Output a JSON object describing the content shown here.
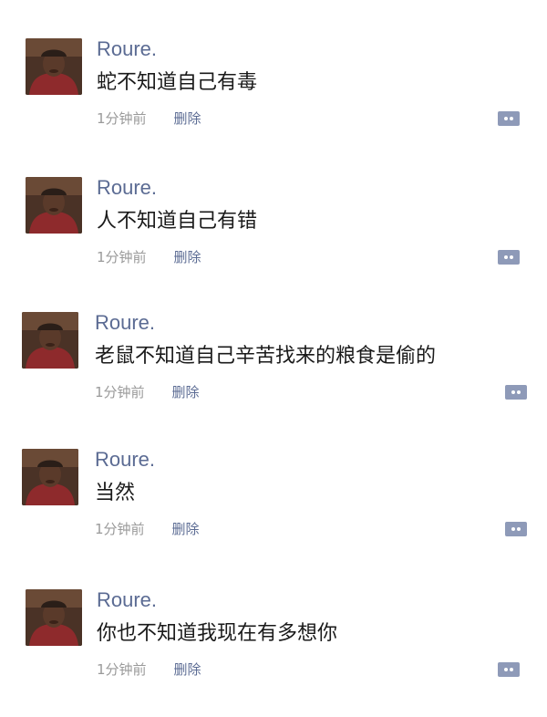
{
  "colors": {
    "name": "#5b6b93",
    "content": "#1a1a1a",
    "time": "#9a9a9a",
    "delete": "#5b6b93",
    "comment_icon": "#8e9ab8"
  },
  "posts": [
    {
      "author": "Roure.",
      "content": "蛇不知道自己有毒",
      "time": "1分钟前",
      "delete_label": "删除",
      "icon": "comment-icon"
    },
    {
      "author": "Roure.",
      "content": "人不知道自己有错",
      "time": "1分钟前",
      "delete_label": "删除",
      "icon": "comment-icon"
    },
    {
      "author": "Roure.",
      "content": "老鼠不知道自己辛苦找来的粮食是偷的",
      "time": "1分钟前",
      "delete_label": "删除",
      "icon": "comment-icon"
    },
    {
      "author": "Roure.",
      "content": "当然",
      "time": "1分钟前",
      "delete_label": "删除",
      "icon": "comment-icon"
    },
    {
      "author": "Roure.",
      "content": "你也不知道我现在有多想你",
      "time": "1分钟前",
      "delete_label": "删除",
      "icon": "comment-icon"
    }
  ]
}
